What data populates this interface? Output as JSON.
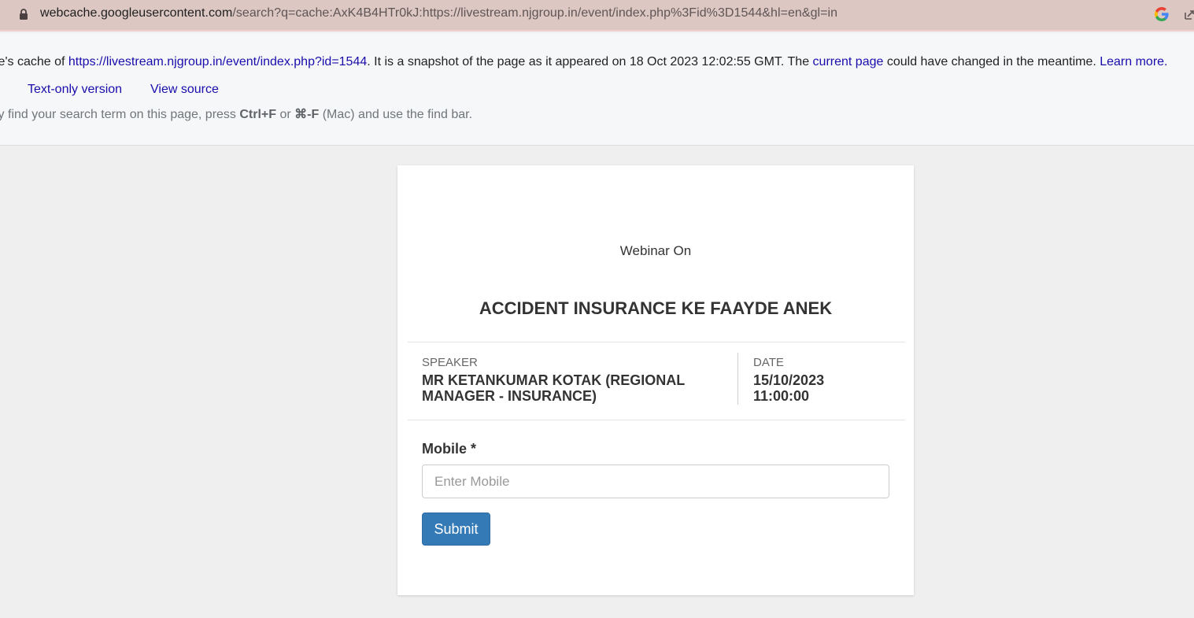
{
  "browser": {
    "url_host": "webcache.googleusercontent.com",
    "url_rest": "/search?q=cache:AxK4B4HTr0kJ:https://livestream.njgroup.in/event/index.php%3Fid%3D1544&hl=en&gl=in"
  },
  "cache_banner": {
    "prefix": "le's cache of ",
    "cached_url": "https://livestream.njgroup.in/event/index.php?id=1544",
    "snapshot_text": ". It is a snapshot of the page as it appeared on 18 Oct 2023 12:02:55 GMT. The ",
    "current_page_link": "current page",
    "changed_text": " could have changed in the meantime. ",
    "learn_more_link": "Learn more.",
    "text_only_link": "Text-only version",
    "view_source_link": "View source",
    "tip_prefix": "ly find your search term on this page, press ",
    "tip_key1": "Ctrl+F",
    "tip_or": " or ",
    "tip_key2": "⌘-F",
    "tip_suffix": " (Mac) and use the find bar."
  },
  "event": {
    "webinar_label": "Webinar On",
    "title": "ACCIDENT INSURANCE KE FAAYDE ANEK",
    "speaker_label": "SPEAKER",
    "speaker_line1": "MR KETANKUMAR KOTAK (REGIONAL",
    "speaker_line2": "MANAGER - INSURANCE)",
    "date_label": "DATE",
    "date_value": "15/10/2023",
    "time_value": "11:00:00"
  },
  "form": {
    "mobile_label": "Mobile *",
    "mobile_placeholder": "Enter Mobile",
    "mobile_value": "",
    "submit_label": "Submit"
  },
  "colors": {
    "address_bar": "#dcc7c3",
    "link": "#1a0dab",
    "submit_button": "#337ab7"
  }
}
